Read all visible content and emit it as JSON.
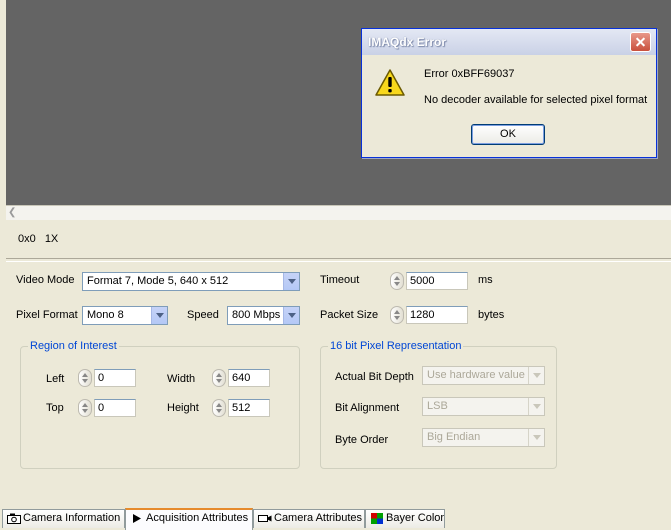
{
  "viewer": {
    "zoom_text": "0x0",
    "zoom_factor": "1X"
  },
  "acquisition": {
    "video_mode_label": "Video Mode",
    "video_mode_value": "Format 7, Mode 5, 640 x 512",
    "pixel_format_label": "Pixel Format",
    "pixel_format_value": "Mono 8",
    "speed_label": "Speed",
    "speed_value": "800 Mbps",
    "timeout_label": "Timeout",
    "timeout_value": "5000",
    "timeout_unit": "ms",
    "packet_size_label": "Packet Size",
    "packet_size_value": "1280",
    "packet_size_unit": "bytes"
  },
  "roi": {
    "title": "Region of Interest",
    "left_label": "Left",
    "left_value": "0",
    "top_label": "Top",
    "top_value": "0",
    "width_label": "Width",
    "width_value": "640",
    "height_label": "Height",
    "height_value": "512"
  },
  "pixel_rep": {
    "title": "16 bit Pixel Representation",
    "actual_bit_depth_label": "Actual Bit Depth",
    "actual_bit_depth_value": "Use hardware value",
    "bit_alignment_label": "Bit Alignment",
    "bit_alignment_value": "LSB",
    "byte_order_label": "Byte Order",
    "byte_order_value": "Big Endian"
  },
  "dialog": {
    "title": "IMAQdx Error",
    "error_code": "Error 0xBFF69037",
    "message": "No decoder available for selected pixel format",
    "ok_label": "OK"
  },
  "tabs": [
    {
      "label": "Camera Information",
      "icon": "camera-info-icon"
    },
    {
      "label": "Acquisition Attributes",
      "icon": "play-arrow-icon"
    },
    {
      "label": "Camera Attributes",
      "icon": "video-camera-icon"
    },
    {
      "label": "Bayer Color",
      "icon": "color-grid-icon"
    }
  ],
  "colors": {
    "viewer_bg": "#646464",
    "dialog_border": "#0831d9",
    "group_title": "#0046d5",
    "active_tab_accent": "#e68b2c"
  }
}
